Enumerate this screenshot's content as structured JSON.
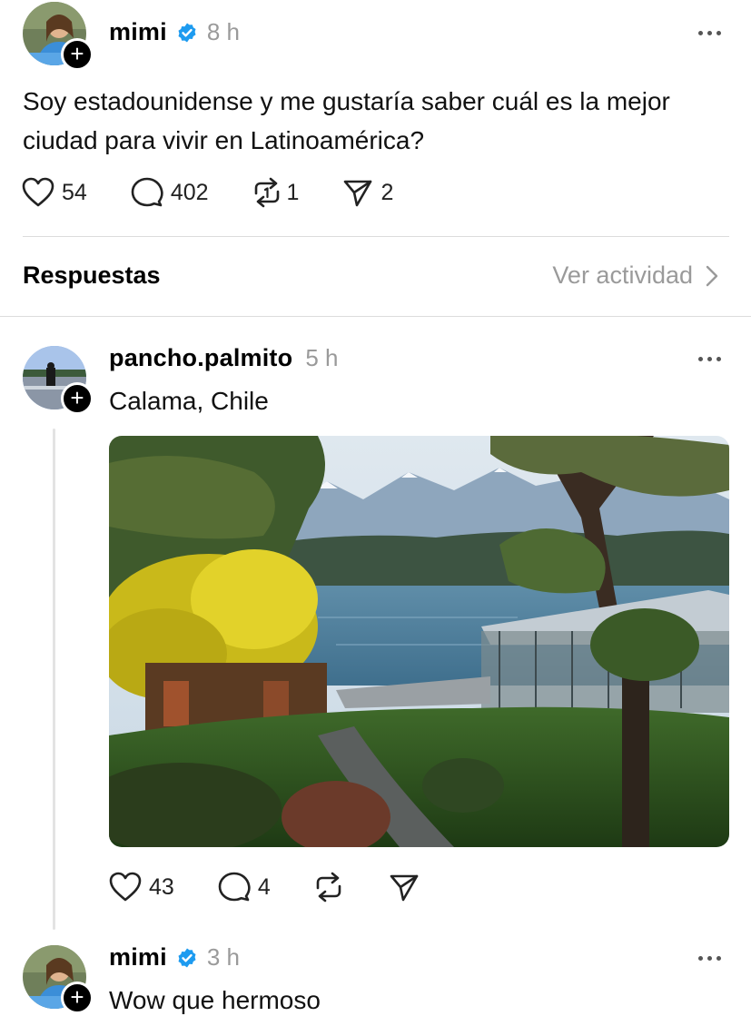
{
  "post": {
    "username": "mimi",
    "time": "8 h",
    "text": "Soy estadounidense y me gustaría saber cuál es la mejor ciudad para vivir en Latinoamérica?",
    "likes": "54",
    "comments": "402",
    "reposts": "1",
    "shares": "2"
  },
  "replies_header": {
    "title": "Respuestas",
    "activity_link": "Ver actividad"
  },
  "reply1": {
    "username": "pancho.palmito",
    "time": "5 h",
    "text": "Calama, Chile",
    "image_description_icon": "photo",
    "likes": "43",
    "comments": "4"
  },
  "reply2": {
    "username": "mimi",
    "time": "3 h",
    "text": "Wow que hermoso"
  },
  "icons": {
    "like": "heart-icon",
    "comment": "comment-bubble-icon",
    "repost": "repost-icon",
    "share": "send-icon",
    "more": "more-dots-icon",
    "verified": "verified-badge-icon",
    "follow": "plus-icon",
    "chevron": "chevron-right-icon"
  },
  "colors": {
    "verified": "#1d9bf0",
    "muted": "#9a9a9a",
    "divider": "#dcdcdc"
  }
}
